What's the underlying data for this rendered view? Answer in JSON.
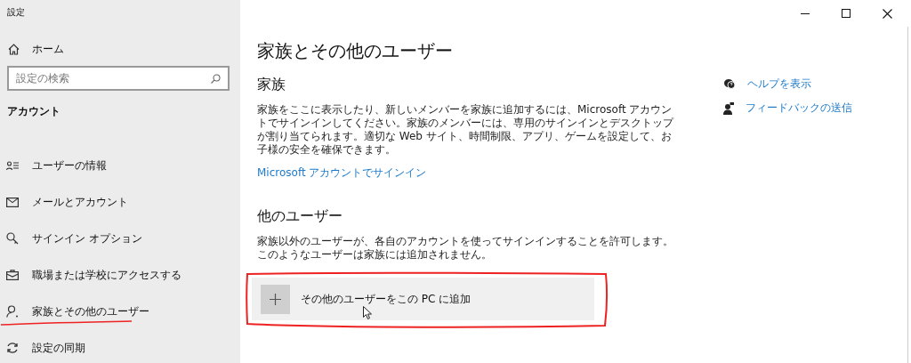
{
  "window": {
    "title": "設定"
  },
  "sidebar": {
    "home": "ホーム",
    "search": {
      "placeholder": "設定の検索"
    },
    "section": "アカウント",
    "items": [
      {
        "label": "ユーザーの情報",
        "selected": false
      },
      {
        "label": "メールとアカウント",
        "selected": false
      },
      {
        "label": "サインイン オプション",
        "selected": false
      },
      {
        "label": "職場または学校にアクセスする",
        "selected": false
      },
      {
        "label": "家族とその他のユーザー",
        "selected": true
      },
      {
        "label": "設定の同期",
        "selected": false
      }
    ]
  },
  "main": {
    "title": "家族とその他のユーザー",
    "family": {
      "heading": "家族",
      "text": "家族をここに表示したり、新しいメンバーを家族に追加するには、Microsoft アカウントでサインインしてください。家族のメンバーには、専用のサインインとデスクトップが割り当てられます。適切な Web サイト、時間制限、アプリ、ゲームを設定して、お子様の安全を確保できます。",
      "link": "Microsoft アカウントでサインイン"
    },
    "others": {
      "heading": "他のユーザー",
      "text": "家族以外のユーザーが、各自のアカウントを使ってサインインすることを許可します。このようなユーザーは家族には追加されません。",
      "add_button": "その他のユーザーをこの PC に追加",
      "highlighted": true
    }
  },
  "help_links": [
    {
      "label": "ヘルプを表示"
    },
    {
      "label": "フィードバックの送信"
    }
  ]
}
